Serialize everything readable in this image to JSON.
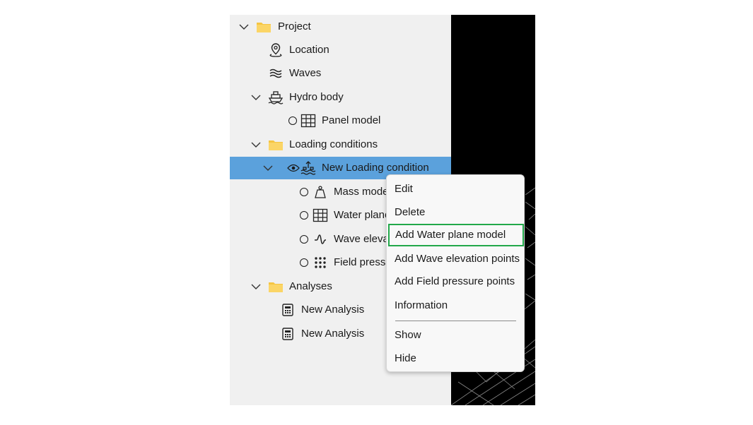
{
  "tree": {
    "project": {
      "label": "Project",
      "icon": "folder-icon"
    },
    "location": {
      "label": "Location",
      "icon": "location-pin-icon"
    },
    "waves": {
      "label": "Waves",
      "icon": "waves-icon"
    },
    "hydro_body": {
      "label": "Hydro body",
      "icon": "ship-icon"
    },
    "panel_model": {
      "label": "Panel model",
      "icon": "grid-icon"
    },
    "loading_conditions": {
      "label": "Loading conditions",
      "icon": "folder-icon"
    },
    "new_loading_condition": {
      "label": "New Loading condition",
      "icon": "loading-condition-icon",
      "selected": true
    },
    "mass_model": {
      "label": "Mass model",
      "icon": "mass-weight-icon"
    },
    "water_plane": {
      "label": "Water plane",
      "icon": "grid-icon"
    },
    "wave_elevation": {
      "label": "Wave elevation",
      "icon": "wave-signal-icon"
    },
    "field_pressure": {
      "label": "Field pressure",
      "icon": "dots-grid-icon"
    },
    "analyses": {
      "label": "Analyses",
      "icon": "folder-icon"
    },
    "analysis_1": {
      "label": "New Analysis",
      "icon": "calculator-icon"
    },
    "analysis_2": {
      "label": "New Analysis",
      "icon": "calculator-icon"
    }
  },
  "context_menu": {
    "items": [
      "Edit",
      "Delete",
      "Add Water plane model",
      "Add Wave elevation points",
      "Add Field pressure points",
      "Information",
      "Show",
      "Hide"
    ],
    "highlighted": "Add Water plane model"
  },
  "colors": {
    "panel_bg": "#f0f0f0",
    "selection": "#5ba1dc",
    "folder": "#f5c542",
    "highlight_border": "#22a84a",
    "viewport_bg": "#000000"
  }
}
